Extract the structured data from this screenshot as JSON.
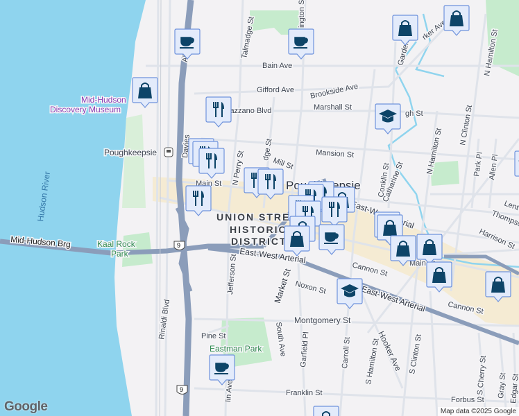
{
  "colors": {
    "water": "#8fd4ee",
    "land": "#f3f2f4",
    "highway": "#8b9dba",
    "road": "#dfe3ea",
    "park": "#c6ebcd",
    "downtown": "#f5ebd3",
    "marker_fill": "#e3ebfb",
    "marker_border": "#6f93dc",
    "marker_icon": "#0d4468"
  },
  "labels": {
    "talmadge": "Talmadge St",
    "washington": "ington St",
    "bain": "Bain Ave",
    "gifford": "Gifford Ave",
    "brookside": "Brookside Ave",
    "verrazzano": "errazzano Blvd",
    "marshall": "Marshall St",
    "high": "gh St",
    "garden": "Garden St",
    "parker": "rker Ave",
    "n_hamilton_top": "N Hamilton St",
    "n_clinton": "N Clinton St",
    "mansion": "Mansion St",
    "mill": "Mill St",
    "bridge": "dge St",
    "n_perry": "N Perry St",
    "station": "Poughkeepsie",
    "main_w": "Main St",
    "city": "Poughkeepsie",
    "conklin": "Conklin St",
    "catharine": "Catharine St",
    "n_hamilton": "N Hamilton St",
    "park_pl": "Park Pl",
    "allen_pl": "Allen Pl",
    "lent": "Lent",
    "thompson": "Thompso",
    "harrison": "Harrison St",
    "arterial_ne": "East-West Arterial",
    "arterial_w": "East-West Arterial",
    "arterial_se": "East-West Arterial",
    "union1": "UNION STREET",
    "union2": "HISTORIC",
    "union3": "DISTRICT",
    "bridge_name": "Mid-Hudson Brg",
    "kaal1": "Kaal Rock",
    "kaal2": "Park",
    "river": "Hudson River",
    "museum1": "Mid-Hudson",
    "museum2": "Discovery Museum",
    "rinaldi": "Rinaldi Blvd",
    "jefferson": "Jefferson St",
    "market": "Market St",
    "noxon": "Noxon St",
    "cannon_w": "Cannon St",
    "cannon_e": "Cannon St",
    "main_e": "Main St",
    "montgomery": "Montgomery St",
    "hooker": "Hooker Ave",
    "pine": "Pine St",
    "eastman": "Eastman Park",
    "south_ave": "South Ave",
    "garfield": "Garfield Pl",
    "carroll": "Carroll St",
    "s_hamilton": "S Hamilton St",
    "s_clinton": "S Clinton St",
    "s_cherry": "S Cherry St",
    "gray": "Gray St",
    "edgar": "Edgar St",
    "franklin": "Franklin St",
    "forbus": "Forbus St",
    "lin_ave": "lin Ave",
    "davies": "Davies",
    "alb": "Alb",
    "route9": "9"
  },
  "attribution": "Map data ©2025 Google",
  "logo": "Google"
}
